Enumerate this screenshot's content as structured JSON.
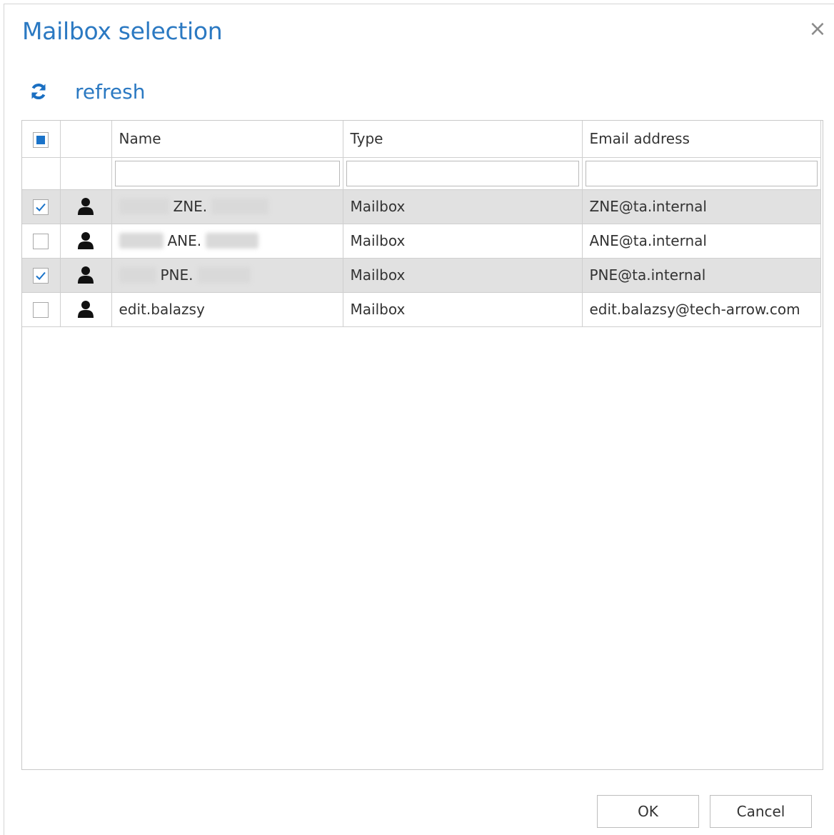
{
  "dialog": {
    "title": "Mailbox selection",
    "close_glyph": "×"
  },
  "toolbar": {
    "refresh_icon": "refresh-icon",
    "refresh_label": "refresh"
  },
  "grid": {
    "columns": [
      "Name",
      "Type",
      "Email address"
    ],
    "header_checkbox_state": "indeterminate",
    "filters": {
      "name": "",
      "type": "",
      "email": ""
    },
    "rows": [
      {
        "checked": true,
        "icon": "user-icon",
        "name": "ZNE.",
        "name_redacted": true,
        "type": "Mailbox",
        "email": "ZNE@ta.internal"
      },
      {
        "checked": false,
        "icon": "user-icon",
        "name": "ANE.",
        "name_redacted": true,
        "type": "Mailbox",
        "email": "ANE@ta.internal"
      },
      {
        "checked": true,
        "icon": "user-icon",
        "name": "PNE.",
        "name_redacted": true,
        "type": "Mailbox",
        "email": "PNE@ta.internal"
      },
      {
        "checked": false,
        "icon": "user-icon",
        "name": "edit.balazsy",
        "name_redacted": false,
        "type": "Mailbox",
        "email": "edit.balazsy@tech-arrow.com"
      }
    ]
  },
  "buttons": {
    "ok_label": "OK",
    "cancel_label": "Cancel"
  },
  "colors": {
    "accent": "#2b79c2",
    "selected_row": "#e1e1e1",
    "checkbox_fill": "#1a73c9"
  }
}
